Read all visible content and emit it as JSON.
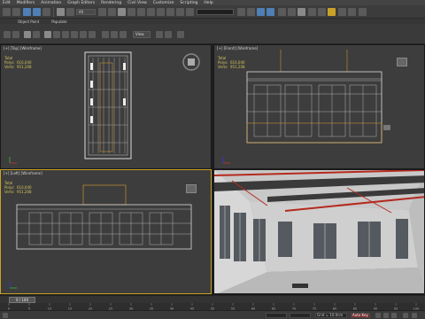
{
  "menu": [
    "Edit",
    "Modifiers",
    "Animation",
    "Graph Editors",
    "Rendering",
    "Civil View",
    "Customize",
    "Scripting",
    "Help"
  ],
  "toolbar": {
    "view_dropdown": "All",
    "selection_set_placeholder": ""
  },
  "ribbon": {
    "tabs": [
      "Object Paint",
      "Populate"
    ]
  },
  "toolbar2": {
    "coordsys": "View"
  },
  "viewports": {
    "top": {
      "label": "[+] [Top] [Wireframe]"
    },
    "front": {
      "label": "[+] [Front] [Wireframe]"
    },
    "left": {
      "label": "[+] [Left] [Wireframe]"
    },
    "stats": {
      "total_label": "Total",
      "polys_label": "Polys:",
      "verts_label": "Verts:",
      "polys": "616,040",
      "verts": "951,208"
    }
  },
  "timeline": {
    "frame": "0 / 100",
    "ticks": [
      "0",
      "5",
      "10",
      "15",
      "20",
      "25",
      "30",
      "35",
      "40",
      "45",
      "50",
      "55",
      "60",
      "65",
      "70",
      "75",
      "80",
      "85",
      "90",
      "95",
      "100"
    ]
  },
  "status": {
    "x": "",
    "y": "",
    "grid": "Grid = 10.0cm",
    "autokey": "Auto Key"
  },
  "colors": {
    "active_border": "#c9a227",
    "wire": "#e0e0e0",
    "highlight": "#e0a030",
    "stats": "#d2c25a"
  }
}
